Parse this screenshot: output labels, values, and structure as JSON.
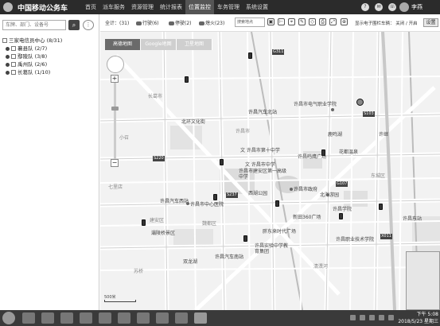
{
  "app": {
    "brand": "中国移动公务车",
    "nav": [
      "首页",
      "派车服务",
      "资源管理",
      "统计报表",
      "位置监控",
      "车务管理",
      "系统设置"
    ],
    "active_nav": "位置监控",
    "user": "李燕"
  },
  "sidebar": {
    "search_placeholder": "车牌、部门、设备号",
    "tree": [
      {
        "label": "三家电信员中心 (8/31)",
        "level": 0
      },
      {
        "label": "襄县队 (2/7)",
        "level": 1
      },
      {
        "label": "鄢陵队 (3/8)",
        "level": 1
      },
      {
        "label": "禹州队 (2/6)",
        "level": 1
      },
      {
        "label": "长葛队 (1/10)",
        "level": 1
      }
    ]
  },
  "toolbar": {
    "legend": [
      {
        "label": "全计：(31)"
      },
      {
        "label": "行驶(6)"
      },
      {
        "label": "停驶(2)"
      },
      {
        "label": "熄火(23)"
      }
    ],
    "address_placeholder": "搜索地点",
    "fence_label": "显示电子围栏车辆：  关闭 / 开启",
    "settings_label": "设置",
    "tool_icons": [
      "layer-icon",
      "ruler-icon",
      "pin-icon",
      "draw-icon",
      "area-icon",
      "print-icon",
      "fullscreen-icon",
      "zoom-icon"
    ]
  },
  "map": {
    "tabs": [
      "高德地图",
      "Google地图",
      "卫星地图"
    ],
    "active_tab": "高德地图",
    "labels": [
      "许昌市电气职业学院",
      "许昌汽车北站",
      "北环文化街",
      "文 许昌市第十中学",
      "文 许昌市中学",
      "许昌市建安区第一高级中学",
      "许昌市政府",
      "许昌市中心医院",
      "许昌汽车西站",
      "西湖公园",
      "北海游园",
      "鹿鸣湖",
      "许昌鸣鹰广场",
      "建安区",
      "新田360广场",
      "胖东来时代广场",
      "许昌汽车南站",
      "许昌职业技术学院",
      "许昌实验中学教育集团",
      "许继",
      "许昌学院",
      "花都温泉",
      "七里店",
      "小召",
      "清潩河",
      "灞陵桥景区",
      "双龙湖",
      "苏桥",
      "东城区",
      "魏都区",
      "许昌市",
      "许昌东站",
      "长葛市"
    ],
    "scale": "500米",
    "badges": [
      "G311",
      "S237",
      "S220",
      "S103",
      "G107",
      "X011"
    ]
  },
  "taskbar": {
    "time": "下午 5:08",
    "date": "2018/5/23 星期三"
  }
}
